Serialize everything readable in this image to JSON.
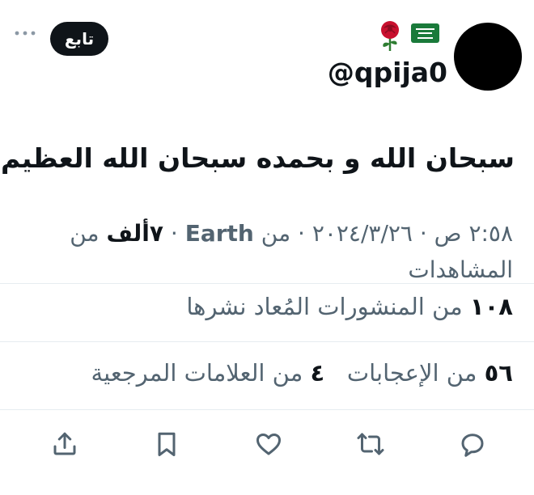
{
  "user": {
    "handle": "@qpija0",
    "follow_label": "تابع",
    "flags": [
      "saudi-flag-icon",
      "rose-icon"
    ]
  },
  "tweet": {
    "text": "سبحان الله و بحمده سبحان الله العظيم"
  },
  "meta": {
    "time": "٢:٥٨ ص",
    "date": "٢٠٢٤/٣/٢٦",
    "source_prefix": "من",
    "source": "Earth",
    "views_count": "٧ألف",
    "views_label": "من المشاهدات",
    "separator": "·"
  },
  "stats": {
    "reposts_count": "١٠٨",
    "reposts_label": "من المنشورات المُعاد نشرها",
    "likes_count": "٥٦",
    "likes_label": "من الإعجابات",
    "bookmarks_count": "٤",
    "bookmarks_label": "من العلامات المرجعية"
  },
  "actions": [
    "reply-icon",
    "repost-icon",
    "like-icon",
    "bookmark-icon",
    "share-icon"
  ],
  "colors": {
    "text": "#0f1419",
    "secondary": "#536471",
    "divider": "#e6ecf0",
    "flag_green": "#1a7a3a"
  }
}
